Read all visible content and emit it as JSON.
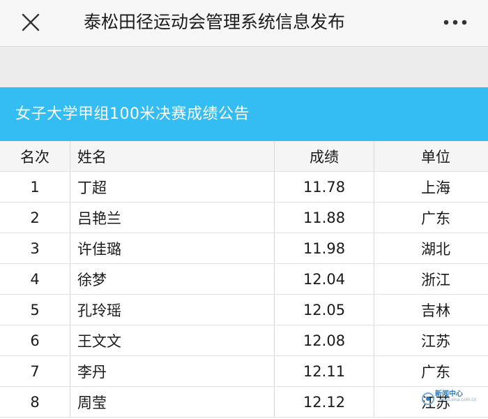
{
  "nav": {
    "title": "泰松田径运动会管理系统信息发布",
    "close_icon": "close-icon",
    "more_icon": "more-dots-icon"
  },
  "banner": {
    "title": "女子大学甲组100米决赛成绩公告",
    "color": "#33bdf2"
  },
  "table": {
    "headers": {
      "rank": "名次",
      "name": "姓名",
      "score": "成绩",
      "unit": "单位"
    },
    "rows": [
      {
        "rank": "1",
        "name": "丁超",
        "score": "11.78",
        "unit": "上海"
      },
      {
        "rank": "2",
        "name": "吕艳兰",
        "score": "11.88",
        "unit": "广东"
      },
      {
        "rank": "3",
        "name": "许佳璐",
        "score": "11.98",
        "unit": "湖北"
      },
      {
        "rank": "4",
        "name": "徐梦",
        "score": "12.04",
        "unit": "浙江"
      },
      {
        "rank": "5",
        "name": "孔玲瑶",
        "score": "12.05",
        "unit": "吉林"
      },
      {
        "rank": "6",
        "name": "王文文",
        "score": "12.08",
        "unit": "江苏"
      },
      {
        "rank": "7",
        "name": "李丹",
        "score": "12.11",
        "unit": "广东"
      },
      {
        "rank": "8",
        "name": "周莹",
        "score": "12.12",
        "unit": "江苏"
      }
    ]
  },
  "watermark": {
    "text": "新闻中心",
    "subtext": "news.sina.com.cn",
    "icon": "news-logo-icon"
  }
}
